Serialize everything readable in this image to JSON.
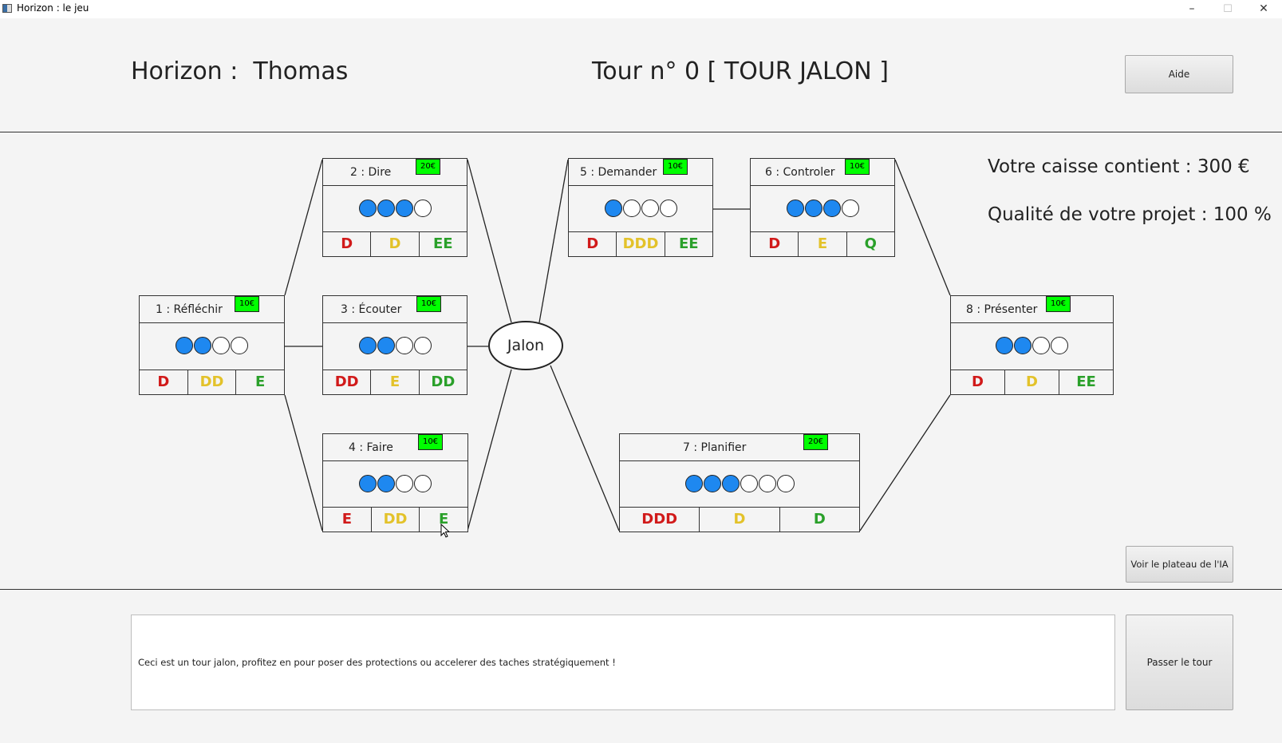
{
  "window": {
    "title": "Horizon : le jeu",
    "minimize": "–",
    "maximize": "☐",
    "close": "✕"
  },
  "header": {
    "player": "Horizon :  Thomas",
    "turn": "Tour n° 0 [ TOUR JALON ]",
    "help_label": "Aide"
  },
  "stats": {
    "cash": "Votre caisse contient : 300 €",
    "quality": "Qualité de votre projet : 100 %"
  },
  "milestone": {
    "label": "Jalon"
  },
  "tasks": [
    {
      "label": "1 : Réfléchir",
      "price": "10€",
      "dots_filled": 2,
      "dots_total": 4,
      "costs": [
        "D",
        "DD",
        "E"
      ]
    },
    {
      "label": "2 : Dire",
      "price": "20€",
      "dots_filled": 3,
      "dots_total": 4,
      "costs": [
        "D",
        "D",
        "EE"
      ]
    },
    {
      "label": "3 : Écouter",
      "price": "10€",
      "dots_filled": 2,
      "dots_total": 4,
      "costs": [
        "DD",
        "E",
        "DD"
      ]
    },
    {
      "label": "4 : Faire",
      "price": "10€",
      "dots_filled": 2,
      "dots_total": 4,
      "costs": [
        "E",
        "DD",
        "E"
      ]
    },
    {
      "label": "5 : Demander",
      "price": "10€",
      "dots_filled": 1,
      "dots_total": 4,
      "costs": [
        "D",
        "DDD",
        "EE"
      ]
    },
    {
      "label": "6 : Controler",
      "price": "10€",
      "dots_filled": 3,
      "dots_total": 4,
      "costs": [
        "D",
        "E",
        "Q"
      ]
    },
    {
      "label": "7 : Planifier",
      "price": "20€",
      "dots_filled": 3,
      "dots_total": 6,
      "costs": [
        "DDD",
        "D",
        "D"
      ]
    },
    {
      "label": "8 : Présenter",
      "price": "10€",
      "dots_filled": 2,
      "dots_total": 4,
      "costs": [
        "D",
        "D",
        "EE"
      ]
    }
  ],
  "ai_board_label": "Voir le plateau de l'IA",
  "message": "Ceci est un tour jalon, profitez en pour poser des protections ou accelerer des taches stratégiquement !",
  "pass_turn_label": "Passer le tour",
  "colors": {
    "progress_dot": "#1e88f0",
    "price_tag": "#00ff00",
    "red": "#d11a1a",
    "yellow": "#e3c22a",
    "green": "#2aa02a"
  }
}
